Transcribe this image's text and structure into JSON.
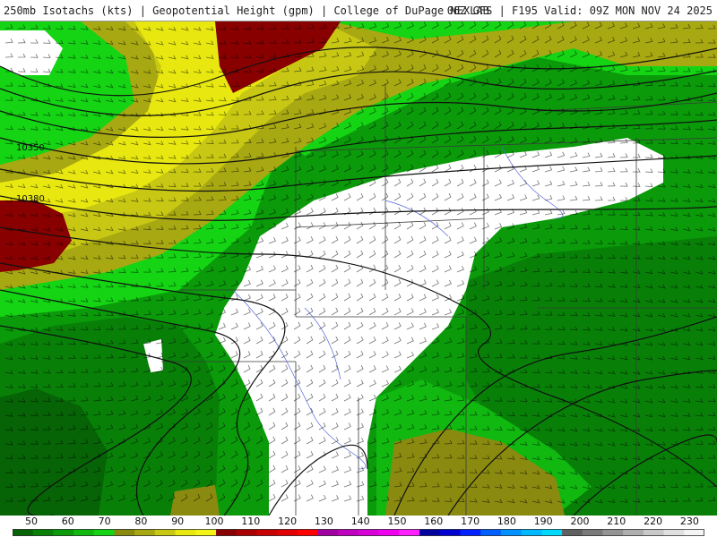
{
  "header": {
    "title_left": "250mb Isotachs (kts) | Geopotential Height (gpm) | College of DuPage NEXLAB",
    "title_right": "06Z GFS | F195 Valid: 09Z MON NOV 24 2025"
  },
  "map": {
    "contour_labels": [
      "10350",
      "10380"
    ],
    "barb_color": "#000000",
    "state_border_color": "#3a3a3a",
    "river_color": "#5566dd"
  },
  "colorbar": {
    "labels": [
      "50",
      "60",
      "70",
      "80",
      "90",
      "100",
      "110",
      "120",
      "130",
      "140",
      "150",
      "160",
      "170",
      "180",
      "190",
      "200",
      "210",
      "220",
      "230"
    ],
    "colors": [
      "#066306",
      "#088008",
      "#0a9a0a",
      "#10b810",
      "#14d414",
      "#8a8a10",
      "#a8a812",
      "#c8c814",
      "#e8e810",
      "#f4f418",
      "#880000",
      "#aa0000",
      "#c80000",
      "#e00000",
      "#ff0000",
      "#a000a0",
      "#c000c0",
      "#d800d8",
      "#f000f0",
      "#ff20ff",
      "#0000a0",
      "#0000d0",
      "#0020ff",
      "#0060ff",
      "#0090ff",
      "#00b8ff",
      "#00d8ff",
      "#606060",
      "#7a7a7a",
      "#949494",
      "#aeaeae",
      "#c8c8c8",
      "#e0e0e0",
      "#f4f4f4"
    ]
  }
}
